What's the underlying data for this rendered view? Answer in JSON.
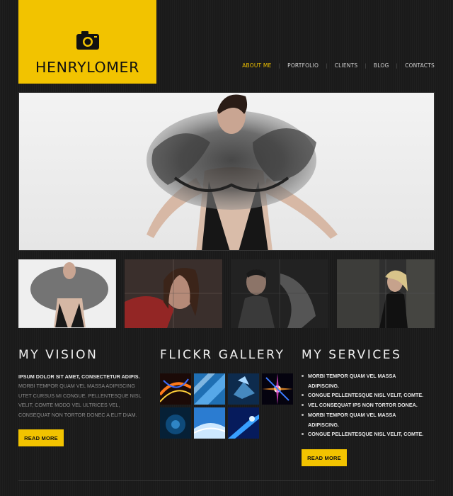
{
  "brand": {
    "first": "HENRY",
    "last": "LOMER"
  },
  "nav": [
    {
      "label": "ABOUT ME",
      "active": true
    },
    {
      "label": "PORTFOLIO",
      "active": false
    },
    {
      "label": "CLIENTS",
      "active": false
    },
    {
      "label": "BLOG",
      "active": false
    },
    {
      "label": "CONTACTS",
      "active": false
    }
  ],
  "colors": {
    "accent": "#f2c300",
    "background": "#1a1a1a"
  },
  "vision": {
    "title": "MY VISION",
    "lead": "IPSUM DOLOR SIT AMET, CONSECTETUR ADIPIS.",
    "body_lines": [
      "MORBI TEMPOR QUAM VEL MASSA ADIPISCING",
      "UTET CURSUS MI CONGUE. PELLENTESQUE NISL",
      "VELIT, COMTE MODO VEL ULTRICES VEL,",
      "CONSEQUAT NON TORTOR DONEC A ELIT DIAM."
    ],
    "button": "READ MORE"
  },
  "flickr": {
    "title": "FLICKR GALLERY"
  },
  "services": {
    "title": "MY SERVICES",
    "items": [
      [
        "MORBI TEMPOR QUAM VEL MASSA",
        "ADIPISCING."
      ],
      [
        "CONGUE PELLENTESQUE NISL VELIT, COMTE."
      ],
      [
        "VEL CONSEQUAT IPS NON TORTOR DONEA."
      ],
      [
        "MORBI TEMPOR QUAM VEL MASSA",
        "ADIPISCING."
      ],
      [
        "CONGUE PELLENTESQUE NISL VELIT, COMTE."
      ]
    ],
    "button": "READ MORE"
  }
}
